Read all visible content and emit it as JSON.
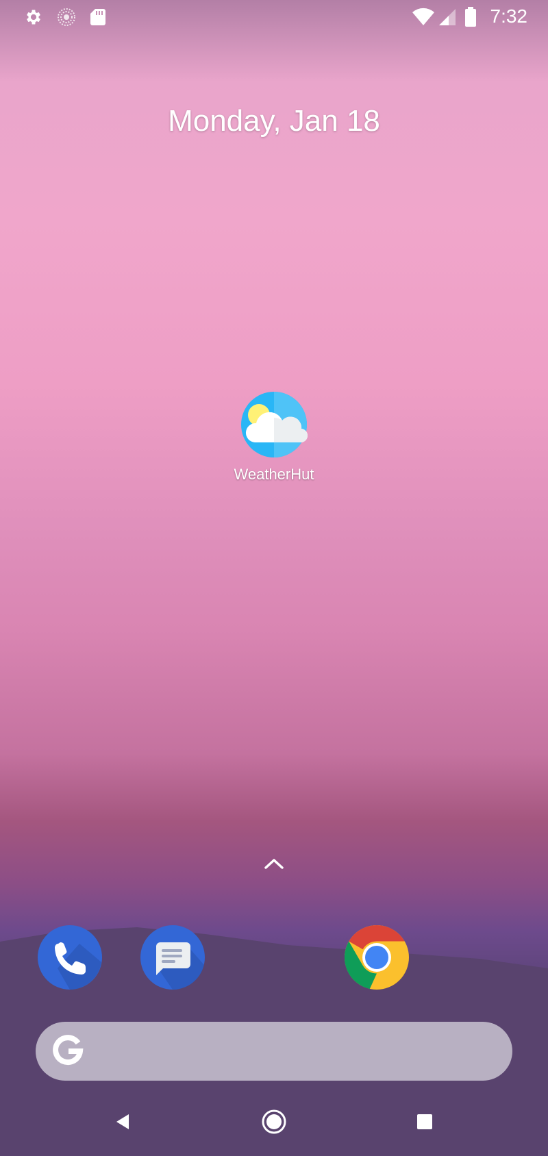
{
  "status_bar": {
    "time": "7:32",
    "left_icons": [
      "settings-icon",
      "sync-icon",
      "sd-card-icon"
    ],
    "right_icons": [
      "wifi-icon",
      "cell-signal-icon",
      "battery-icon"
    ]
  },
  "home": {
    "date": "Monday, Jan 18",
    "apps": [
      {
        "label": "WeatherHut",
        "icon": "weather-icon"
      }
    ]
  },
  "dock": {
    "apps": [
      "phone-icon",
      "messages-icon",
      "chrome-icon"
    ]
  },
  "search": {
    "icon": "google-g-icon"
  },
  "nav": {
    "buttons": [
      "back-icon",
      "home-icon",
      "recents-icon"
    ]
  },
  "colors": {
    "phone_blue": "#3367d6",
    "messages_blue": "#3367d6",
    "weather_sky": "#29b6f6",
    "sun_yellow": "#fff176"
  }
}
